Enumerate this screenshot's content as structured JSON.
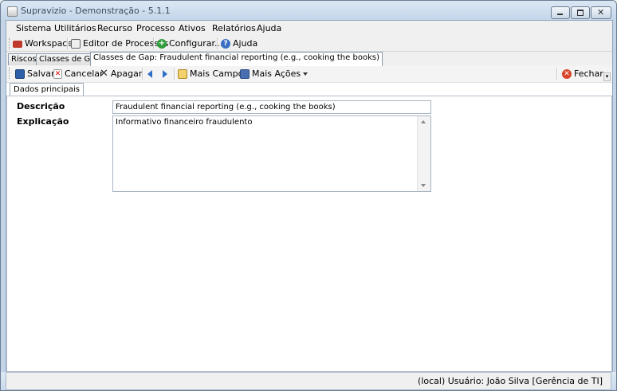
{
  "window": {
    "title": "Supravizio - Demonstração - 5.1.1"
  },
  "menubar": {
    "items": [
      {
        "label": "Sistema"
      },
      {
        "label": "Utilitários"
      },
      {
        "label": "Recurso"
      },
      {
        "label": "Processo"
      },
      {
        "label": "Ativos"
      },
      {
        "label": "Relatórios"
      },
      {
        "label": "Ajuda"
      }
    ]
  },
  "toolbar": {
    "workspace_label": "Workspace",
    "editor_label": "Editor de Processos",
    "configurar_label": "Configurar...",
    "ajuda_label": "Ajuda"
  },
  "tabs": [
    {
      "label": "Riscos"
    },
    {
      "label": "Classes de Gap"
    },
    {
      "label": "Classes de Gap: Fraudulent financial reporting (e.g., cooking the books)"
    }
  ],
  "actions": {
    "salvar": "Salvar",
    "cancelar": "Cancelar",
    "apagar": "Apagar",
    "mais_campos": "Mais Campos",
    "mais_acoes": "Mais Ações",
    "fechar": "Fechar"
  },
  "form": {
    "subtab": "Dados principais",
    "descricao_label": "Descrição",
    "descricao_value": "Fraudulent financial reporting (e.g., cooking the books)",
    "explicacao_label": "Explicação",
    "explicacao_value": "Informativo financeiro fraudulento"
  },
  "status": {
    "text": "(local)  Usuário: João Silva [Gerência de TI]"
  }
}
